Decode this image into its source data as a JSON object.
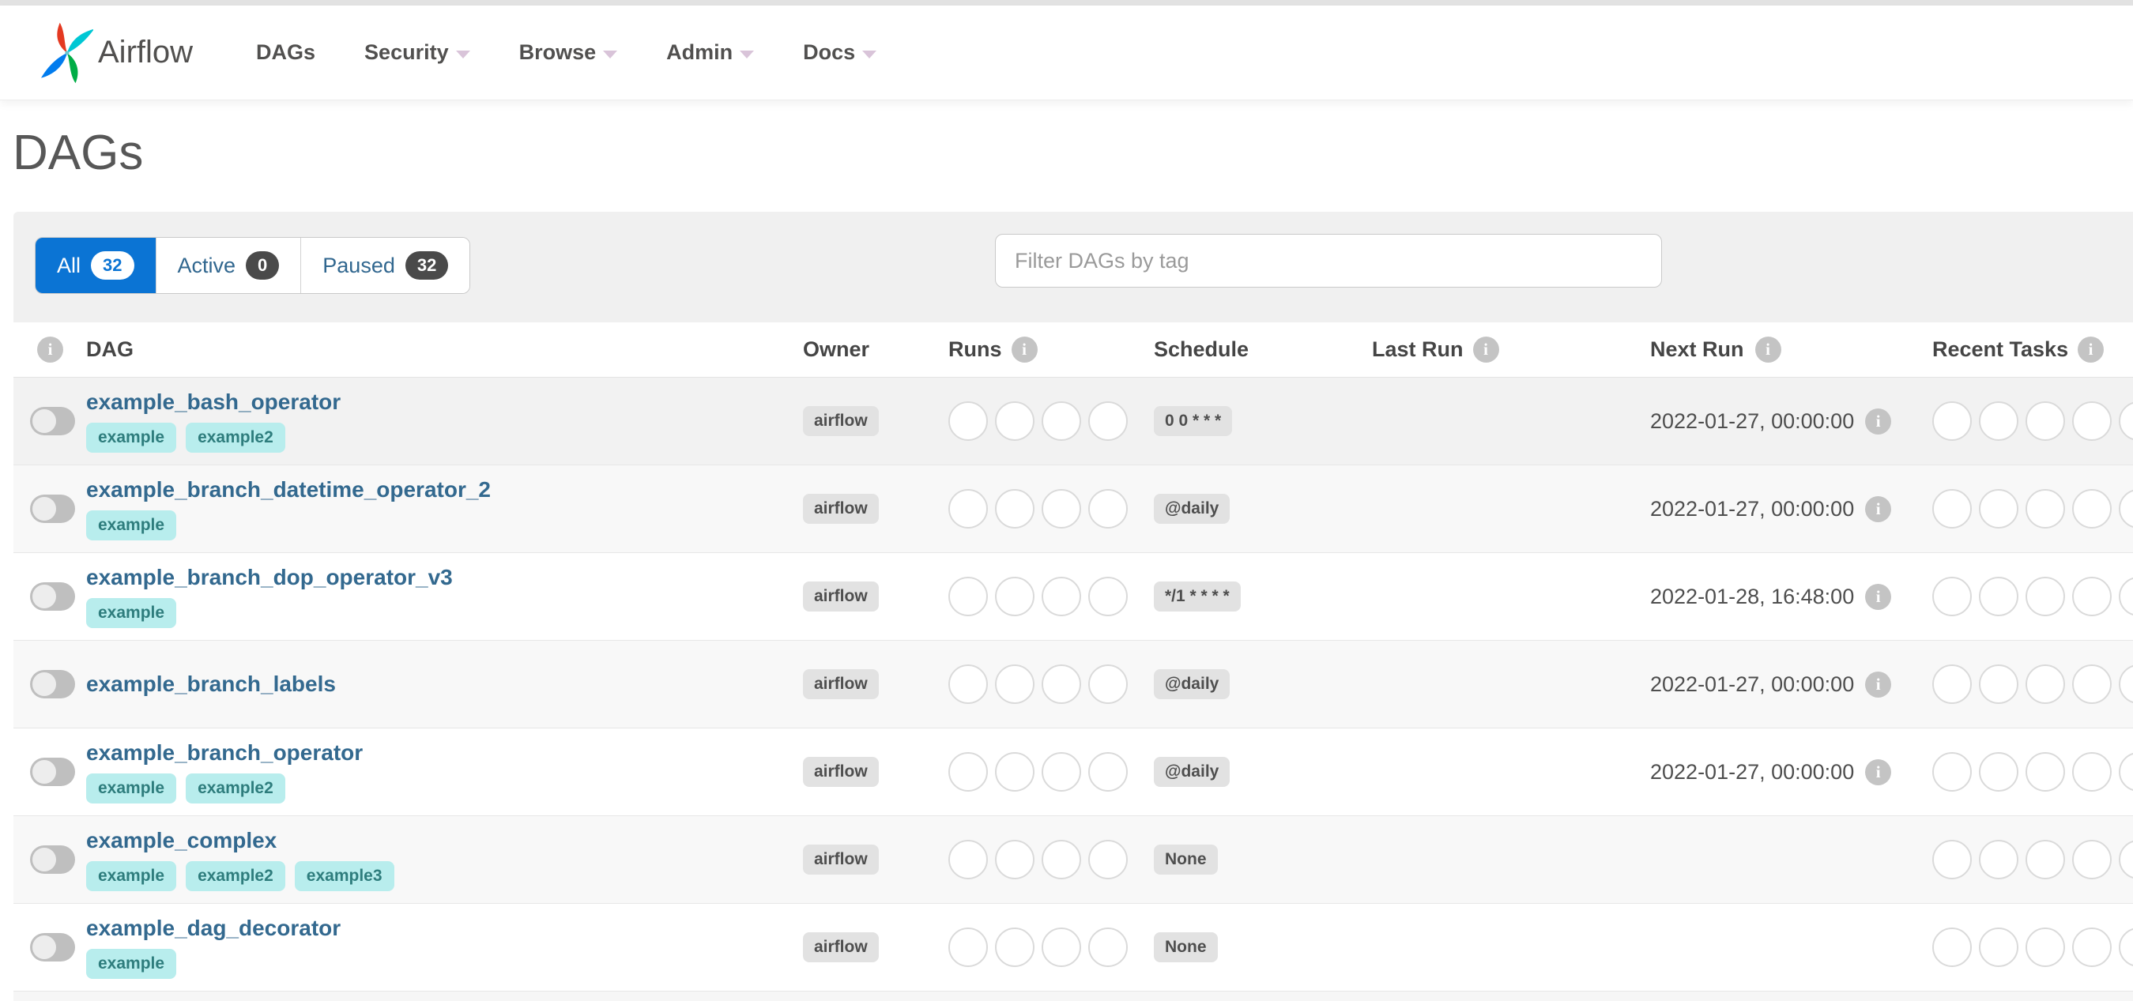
{
  "navbar": {
    "brand": "Airflow",
    "items": [
      {
        "label": "DAGs",
        "caret": false
      },
      {
        "label": "Security",
        "caret": true
      },
      {
        "label": "Browse",
        "caret": true
      },
      {
        "label": "Admin",
        "caret": true
      },
      {
        "label": "Docs",
        "caret": true
      }
    ]
  },
  "page": {
    "title": "DAGs"
  },
  "filters": {
    "tabs": [
      {
        "label": "All",
        "count": "32",
        "active": true
      },
      {
        "label": "Active",
        "count": "0",
        "active": false
      },
      {
        "label": "Paused",
        "count": "32",
        "active": false
      }
    ],
    "search_placeholder": "Filter DAGs by tag"
  },
  "table": {
    "headers": {
      "dag": "DAG",
      "owner": "Owner",
      "runs": "Runs",
      "schedule": "Schedule",
      "last_run": "Last Run",
      "next_run": "Next Run",
      "recent_tasks": "Recent Tasks"
    },
    "rows": [
      {
        "name": "example_bash_operator",
        "tags": [
          "example",
          "example2"
        ],
        "owner": "airflow",
        "paused": true,
        "runs_count": 4,
        "schedule": "0 0 * * *",
        "last_run": "",
        "next_run": "2022-01-27, 00:00:00",
        "recent_tasks_count": 5,
        "bg": "#f2f2f2"
      },
      {
        "name": "example_branch_datetime_operator_2",
        "tags": [
          "example"
        ],
        "owner": "airflow",
        "paused": true,
        "runs_count": 4,
        "schedule": "@daily",
        "last_run": "",
        "next_run": "2022-01-27, 00:00:00",
        "recent_tasks_count": 5,
        "bg": "#f8f8f8"
      },
      {
        "name": "example_branch_dop_operator_v3",
        "tags": [
          "example"
        ],
        "owner": "airflow",
        "paused": true,
        "runs_count": 4,
        "schedule": "*/1 * * * *",
        "last_run": "",
        "next_run": "2022-01-28, 16:48:00",
        "recent_tasks_count": 5,
        "bg": "#ffffff"
      },
      {
        "name": "example_branch_labels",
        "tags": [],
        "owner": "airflow",
        "paused": true,
        "runs_count": 4,
        "schedule": "@daily",
        "last_run": "",
        "next_run": "2022-01-27, 00:00:00",
        "recent_tasks_count": 5,
        "bg": "#f8f8f8"
      },
      {
        "name": "example_branch_operator",
        "tags": [
          "example",
          "example2"
        ],
        "owner": "airflow",
        "paused": true,
        "runs_count": 4,
        "schedule": "@daily",
        "last_run": "",
        "next_run": "2022-01-27, 00:00:00",
        "recent_tasks_count": 5,
        "bg": "#ffffff"
      },
      {
        "name": "example_complex",
        "tags": [
          "example",
          "example2",
          "example3"
        ],
        "owner": "airflow",
        "paused": true,
        "runs_count": 4,
        "schedule": "None",
        "last_run": "",
        "next_run": "",
        "recent_tasks_count": 5,
        "bg": "#f8f8f8"
      },
      {
        "name": "example_dag_decorator",
        "tags": [
          "example"
        ],
        "owner": "airflow",
        "paused": true,
        "runs_count": 4,
        "schedule": "None",
        "last_run": "",
        "next_run": "",
        "recent_tasks_count": 5,
        "bg": "#ffffff"
      }
    ]
  },
  "colors": {
    "primary_blue": "#0b74d4",
    "link_blue": "#33698f",
    "tag_bg": "#b8eded",
    "tag_text": "#2e7d7d",
    "badge_bg": "#e2e2e2",
    "badge_text": "#4e4e4e",
    "dark_count_badge": "#4a4a4a",
    "toggle_track": "#bfbfbf",
    "circle_border": "#dadada",
    "panel_bg": "#f0f0f0",
    "logo_red": "#e43921",
    "logo_teal": "#00c7d4",
    "logo_blue": "#017cee",
    "logo_green": "#00ad46"
  }
}
